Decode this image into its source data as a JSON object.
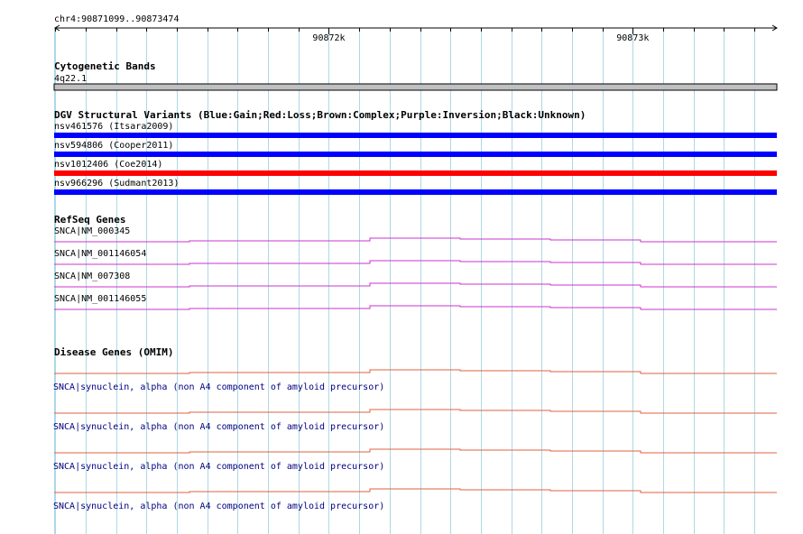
{
  "ruler": {
    "location": "chr4:90871099..90873474",
    "start": 90871099,
    "end": 90873474,
    "major_ticks": [
      {
        "pos": 90872000,
        "label": "90872k"
      },
      {
        "pos": 90873000,
        "label": "90873k"
      }
    ]
  },
  "tracks": {
    "cytoband": {
      "title": "Cytogenetic Bands",
      "label": "4q22.1",
      "color": "#c0c0c0"
    },
    "dgv": {
      "title": "DGV Structural Variants (Blue:Gain;Red:Loss;Brown:Complex;Purple:Inversion;Black:Unknown)",
      "items": [
        {
          "label": "nsv461576 (Itsara2009)",
          "type": "Gain",
          "color": "#0000ff"
        },
        {
          "label": "nsv594806 (Cooper2011)",
          "type": "Gain",
          "color": "#0000ff"
        },
        {
          "label": "nsv1012406 (Coe2014)",
          "type": "Loss",
          "color": "#ff0000"
        },
        {
          "label": "nsv966296 (Sudmant2013)",
          "type": "Gain",
          "color": "#0000ff"
        }
      ]
    },
    "refseq": {
      "title": "RefSeq Genes",
      "color": "#cc33cc",
      "items": [
        {
          "label": "SNCA|NM_000345"
        },
        {
          "label": "SNCA|NM_001146054"
        },
        {
          "label": "SNCA|NM_007308"
        },
        {
          "label": "SNCA|NM_001146055"
        }
      ]
    },
    "omim": {
      "title": "Disease Genes (OMIM)",
      "color": "#e06040",
      "items": [
        {
          "label": "SNCA|synuclein, alpha (non A4 component of amyloid precursor)"
        },
        {
          "label": "SNCA|synuclein, alpha (non A4 component of amyloid precursor)"
        },
        {
          "label": "SNCA|synuclein, alpha (non A4 component of amyloid precursor)"
        },
        {
          "label": "SNCA|synuclein, alpha (non A4 component of amyloid precursor)"
        }
      ]
    }
  }
}
